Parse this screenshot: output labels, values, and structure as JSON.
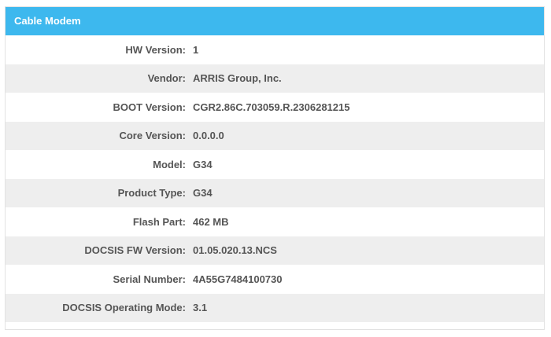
{
  "panel": {
    "title": "Cable Modem"
  },
  "rows": [
    {
      "label": "HW Version:",
      "value": "1"
    },
    {
      "label": "Vendor:",
      "value": "ARRIS Group, Inc."
    },
    {
      "label": "BOOT Version:",
      "value": "CGR2.86C.703059.R.2306281215"
    },
    {
      "label": "Core Version:",
      "value": "0.0.0.0"
    },
    {
      "label": "Model:",
      "value": "G34"
    },
    {
      "label": "Product Type:",
      "value": "G34"
    },
    {
      "label": "Flash Part:",
      "value": "462 MB"
    },
    {
      "label": "DOCSIS FW Version:",
      "value": "01.05.020.13.NCS"
    },
    {
      "label": "Serial Number:",
      "value": "4A55G7484100730"
    },
    {
      "label": "DOCSIS Operating Mode:",
      "value": "3.1"
    }
  ],
  "colors": {
    "header_bg": "#3db8ee",
    "alt_row_bg": "#eeeeee"
  }
}
